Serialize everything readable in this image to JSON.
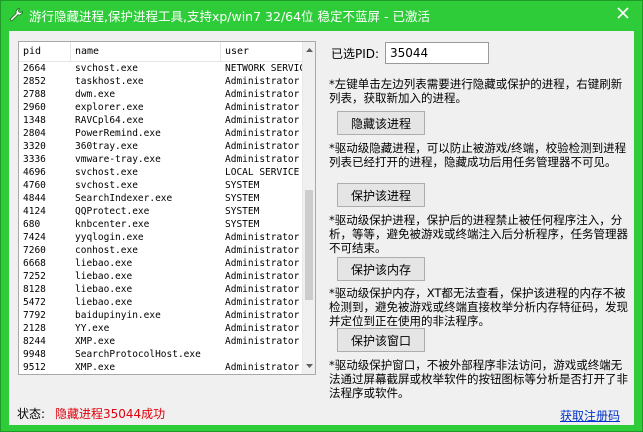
{
  "window": {
    "title": "游行隐藏进程,保护进程工具,支持xp/win7 32/64位 稳定不蓝屏 - 已激活",
    "close_glyph": "✕",
    "accent_color": "#2fcc3a"
  },
  "process_list": {
    "columns": [
      "pid",
      "name",
      "user"
    ],
    "rows": [
      [
        "2664",
        "svchost.exe",
        "NETWORK SERVICE"
      ],
      [
        "2852",
        "taskhost.exe",
        "Administrator"
      ],
      [
        "2788",
        "dwm.exe",
        "Administrator"
      ],
      [
        "2960",
        "explorer.exe",
        "Administrator"
      ],
      [
        "1348",
        "RAVCpl64.exe",
        "Administrator"
      ],
      [
        "2804",
        "PowerRemind.exe",
        "Administrator"
      ],
      [
        "3320",
        "360tray.exe",
        "Administrator"
      ],
      [
        "3336",
        "vmware-tray.exe",
        "Administrator"
      ],
      [
        "4696",
        "svchost.exe",
        "LOCAL SERVICE"
      ],
      [
        "4760",
        "svchost.exe",
        "SYSTEM"
      ],
      [
        "4844",
        "SearchIndexer.exe",
        "SYSTEM"
      ],
      [
        "4124",
        "QQProtect.exe",
        "SYSTEM"
      ],
      [
        "680",
        "knbcenter.exe",
        "SYSTEM"
      ],
      [
        "7424",
        "yyqlogin.exe",
        "Administrator"
      ],
      [
        "7260",
        "conhost.exe",
        "Administrator"
      ],
      [
        "6668",
        "liebao.exe",
        "Administrator"
      ],
      [
        "7252",
        "liebao.exe",
        "Administrator"
      ],
      [
        "8128",
        "liebao.exe",
        "Administrator"
      ],
      [
        "5472",
        "liebao.exe",
        "Administrator"
      ],
      [
        "7792",
        "baidupinyin.exe",
        "Administrator"
      ],
      [
        "2128",
        "YY.exe",
        "Administrator"
      ],
      [
        "8244",
        "XMP.exe",
        "Administrator"
      ],
      [
        "9948",
        "SearchProtocolHost.exe",
        ""
      ],
      [
        "9512",
        "XMP.exe",
        "Administrator"
      ]
    ]
  },
  "pid_field": {
    "label": "已选PID:",
    "value": "35044"
  },
  "descriptions": {
    "list_help": "*左键单击左边列表需要进行隐藏或保护的进程，右键刷新列表，获取新加入的进程。",
    "hide_help": "*驱动级隐藏进程，可以防止被游戏/终端，校验检测到进程列表已经打开的进程，隐藏成功后用任务管理器不可见。",
    "protect_help": "*驱动级保护进程，保护后的进程禁止被任何程序注入，分析，等等，避免被游戏或终端注入后分析程序，任务管理器不可结束。",
    "memory_help": "*驱动级保护内存，XT都无法查看，保护该进程的内存不被检测到，避免被游戏或终端直接枚举分析内存特征码，发现并定位到正在使用的非法程序。",
    "window_help": "*驱动级保护窗口，不被外部程序非法访问，游戏或终端无法通过屏幕截屏或枚举软件的按钮图标等分析是否打开了非法程序或软件。"
  },
  "buttons": {
    "hide": "隐藏该进程",
    "protect": "保护该进程",
    "memory": "保护该内存",
    "window": "保护该窗口"
  },
  "status": {
    "label": "状态:",
    "text": "隐藏进程35044成功",
    "text_color": "#e0000a"
  },
  "register_link": "获取注册码"
}
